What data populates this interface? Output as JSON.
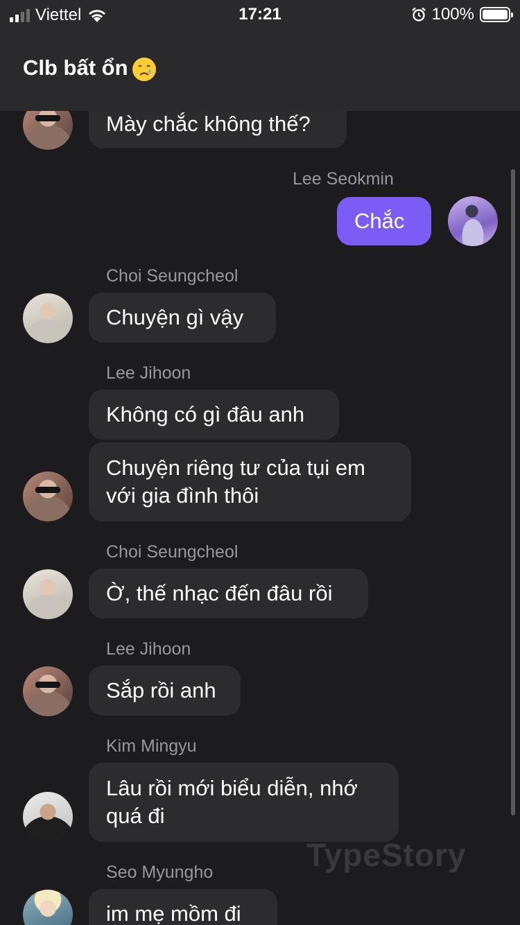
{
  "status_bar": {
    "carrier": "Viettel",
    "time": "17:21",
    "battery": "100%",
    "icons": [
      "signal-icon",
      "wifi-icon",
      "alarm-icon",
      "battery-icon"
    ]
  },
  "header": {
    "title": "Clb bất ổn",
    "title_emoji": "crying-face-emoji"
  },
  "messages": [
    {
      "sender": "",
      "text": "Mày chắc không thế?",
      "avatar": "avatar-lee-jihoon"
    },
    {
      "sender": "Lee Seokmin",
      "text": "Chắc",
      "outgoing": true,
      "avatar": "avatar-lee-seokmin"
    },
    {
      "sender": "Choi Seungcheol",
      "text": "Chuyện gì vậy",
      "avatar": "avatar-choi-seungcheol"
    },
    {
      "sender": "Lee Jihoon",
      "text": "Không có gì đâu anh"
    },
    {
      "sender": "",
      "text": "Chuyện riêng tư của tụi em\nvới gia đình thôi",
      "avatar": "avatar-lee-jihoon"
    },
    {
      "sender": "Choi Seungcheol",
      "text": "Ờ, thế nhạc đến đâu rồi",
      "avatar": "avatar-choi-seungcheol"
    },
    {
      "sender": "Lee Jihoon",
      "text": "Sắp rồi anh",
      "avatar": "avatar-lee-jihoon"
    },
    {
      "sender": "Kim Mingyu",
      "text": "Lâu rồi mới biểu diễn, nhớ\nquá đi",
      "avatar": "avatar-kim-mingyu"
    },
    {
      "sender": "Seo Myungho",
      "text": "im mẹ mồm đi",
      "avatar": "avatar-seo-myungho"
    }
  ],
  "watermark": "TypeStory",
  "colors": {
    "background": "#1c1c1e",
    "header": "#2a2a2c",
    "bubble_incoming": "#2c2c2e",
    "bubble_outgoing": "#7b5cf5",
    "sender_name": "#98989d"
  }
}
